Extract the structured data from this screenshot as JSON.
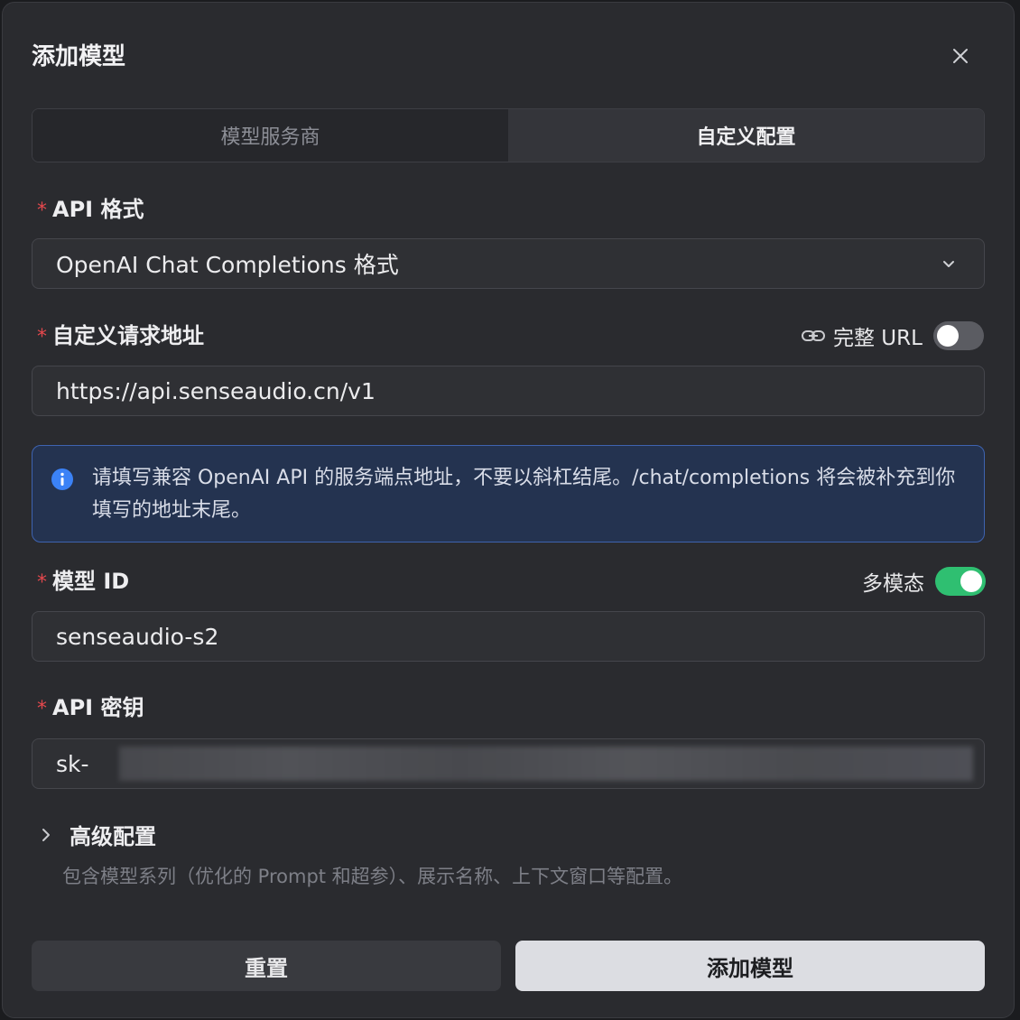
{
  "dialog": {
    "title": "添加模型"
  },
  "tabs": [
    {
      "label": "模型服务商",
      "active": false
    },
    {
      "label": "自定义配置",
      "active": true
    }
  ],
  "api_format": {
    "label": "API 格式",
    "value": "OpenAI Chat Completions 格式"
  },
  "endpoint": {
    "label": "自定义请求地址",
    "full_url_label": "完整 URL",
    "full_url_enabled": false,
    "value": "https://api.senseaudio.cn/v1"
  },
  "info": {
    "text": "请填写兼容 OpenAI API 的服务端点地址，不要以斜杠结尾。/chat/completions 将会被补充到你填写的地址末尾。"
  },
  "model_id": {
    "label": "模型 ID",
    "multimodal_label": "多模态",
    "multimodal_enabled": true,
    "value": "senseaudio-s2"
  },
  "api_key": {
    "label": "API 密钥",
    "value_prefix": "sk-"
  },
  "advanced": {
    "title": "高级配置",
    "description": "包含模型系列（优化的 Prompt 和超参）、展示名称、上下文窗口等配置。"
  },
  "buttons": {
    "reset": "重置",
    "submit": "添加模型"
  },
  "colors": {
    "required": "#e5484d",
    "toggle_on": "#2fbf71",
    "info_border": "#3e63b0",
    "info_icon": "#3b82f6"
  }
}
